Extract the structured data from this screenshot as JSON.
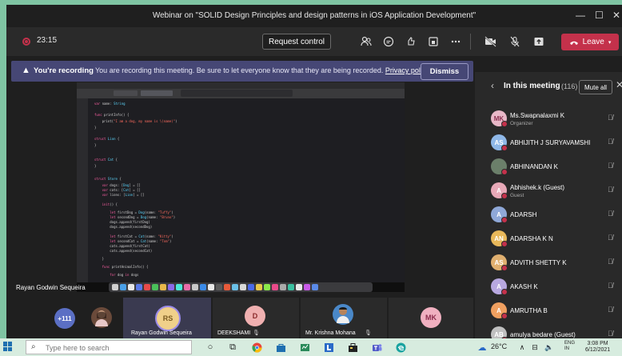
{
  "window": {
    "title": "Webinar on \"SOLID Design Principles and design patterns in iOS Application Development\"",
    "minimize": "—",
    "maximize": "☐",
    "close": "✕"
  },
  "toolbar": {
    "timer": "23:15",
    "request_control": "Request control",
    "leave": "Leave",
    "icons": [
      "people-icon",
      "chat-icon",
      "reactions-icon",
      "rooms-icon",
      "more-icon",
      "camera-off-icon",
      "mic-off-icon",
      "share-icon"
    ]
  },
  "banner": {
    "title": "You're recording",
    "message": "You are recording this meeting. Be sure to let everyone know that they are being recorded.",
    "privacy_link": "Privacy policy",
    "dismiss": "Dismiss"
  },
  "presenter": {
    "name": "Rayan Godwin Sequeira"
  },
  "panel": {
    "title": "In this meeting",
    "count": "(116)",
    "mute_all": "Mute all",
    "participants": [
      {
        "initials": "MK",
        "name": "Ms.Swapnalaxmi K",
        "role": "Organizer",
        "color": "#e8b7c7",
        "text_color": "#8a2f4f"
      },
      {
        "initials": "AS",
        "name": "ABHIJITH J SURYAVAMSHI",
        "role": "",
        "color": "#8fb8e8",
        "text_color": "#ffffff"
      },
      {
        "initials": "",
        "name": "ABHINANDAN K",
        "role": "",
        "color": "#6b7f6a",
        "text_color": "#ffffff"
      },
      {
        "initials": "A",
        "name": "Abhishek.k (Guest)",
        "role": "Guest",
        "color": "#e8a9b8",
        "text_color": "#ffffff"
      },
      {
        "initials": "A",
        "name": "ADARSH",
        "role": "",
        "color": "#8fa8d8",
        "text_color": "#ffffff"
      },
      {
        "initials": "AN",
        "name": "ADARSHA K N",
        "role": "",
        "color": "#e8b85a",
        "text_color": "#ffffff"
      },
      {
        "initials": "AS",
        "name": "ADVITH SHETTY K",
        "role": "",
        "color": "#e0b070",
        "text_color": "#ffffff"
      },
      {
        "initials": "A",
        "name": "AKASH K",
        "role": "",
        "color": "#b8a8e0",
        "text_color": "#ffffff"
      },
      {
        "initials": "A",
        "name": "AMRUTHA B",
        "role": "",
        "color": "#f0a060",
        "text_color": "#ffffff"
      },
      {
        "initials": "AB",
        "name": "amulya bedare (Guest)",
        "role": "",
        "color": "#c0c0c0",
        "text_color": "#ffffff"
      }
    ]
  },
  "gallery": {
    "overflow": "+111",
    "tiles": [
      {
        "initials": "RS",
        "name": "Rayan Godwin Sequeira"
      },
      {
        "initials": "D",
        "name": "DEEKSHAMI"
      },
      {
        "initials": "",
        "name": "Mr. Krishna Mohana"
      },
      {
        "initials": "MK",
        "name": ""
      }
    ]
  },
  "taskbar": {
    "search_placeholder": "Type here to search",
    "temperature": "26°C",
    "lang_top": "ENG",
    "lang_bottom": "IN",
    "time": "3:08 PM",
    "date": "6/12/2021"
  },
  "colors": {
    "leave_red": "#c4314b",
    "banner_purple": "#464775",
    "frame_green": "#7fc4a3"
  }
}
